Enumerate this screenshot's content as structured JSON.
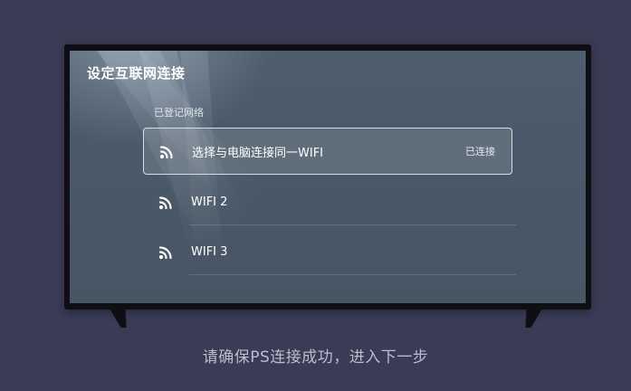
{
  "screen": {
    "title": "设定互联网连接",
    "section_label": "已登记网络",
    "networks": [
      {
        "name": "选择与电脑连接同一WIFI",
        "status": "已连接",
        "icon": "wifi-icon",
        "selected": true
      },
      {
        "name": "WIFI 2",
        "status": "",
        "icon": "wifi-icon",
        "selected": false
      },
      {
        "name": "WIFI 3",
        "status": "",
        "icon": "wifi-icon",
        "selected": false
      }
    ]
  },
  "instruction": "请确保PS连接成功，进入下一步",
  "colors": {
    "background": "#3a3c55",
    "tv_frame": "#0f0f13",
    "screen": "#4a5969",
    "text": "#ffffff"
  }
}
